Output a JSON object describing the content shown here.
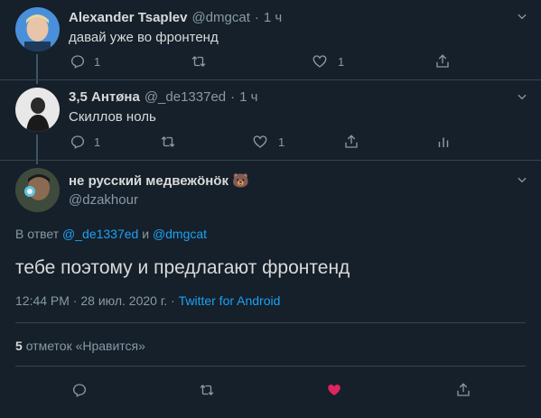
{
  "tweets": [
    {
      "author_name": "Alexander Tsaplev",
      "handle": "@dmgcat",
      "separator": "·",
      "time": "1 ч",
      "text": "давай уже во фронтенд",
      "reply_count": "1",
      "like_count": "1"
    },
    {
      "author_name": "3,5 Антøна",
      "handle": "@_de1337ed",
      "separator": "·",
      "time": "1 ч",
      "text": "Скиллов ноль",
      "reply_count": "1",
      "like_count": "1"
    }
  ],
  "main_tweet": {
    "author_name": "не русский медвежöнöк 🐻",
    "handle": "@dzakhour",
    "reply_prefix": "В ответ",
    "reply_user1": "@_de1337ed",
    "reply_and": "и",
    "reply_user2": "@dmgcat",
    "text": "тебе поэтому и предлагают фронтенд",
    "timestamp": "12:44 PM · 28 июл. 2020 г. ·",
    "source": "Twitter for Android",
    "likes_count": "5",
    "likes_label": "отметок «Нравится»"
  },
  "colors": {
    "background": "#15202b",
    "text": "#d9d9d9",
    "secondary": "#8899a6",
    "accent": "#1da1f2",
    "like": "#e0245e",
    "divider": "#38444d"
  },
  "icons": {
    "reply": "comment-icon",
    "retweet": "retweet-icon",
    "like": "heart-icon",
    "share": "share-icon",
    "analytics": "analytics-icon",
    "menu": "chevron-down-icon"
  }
}
